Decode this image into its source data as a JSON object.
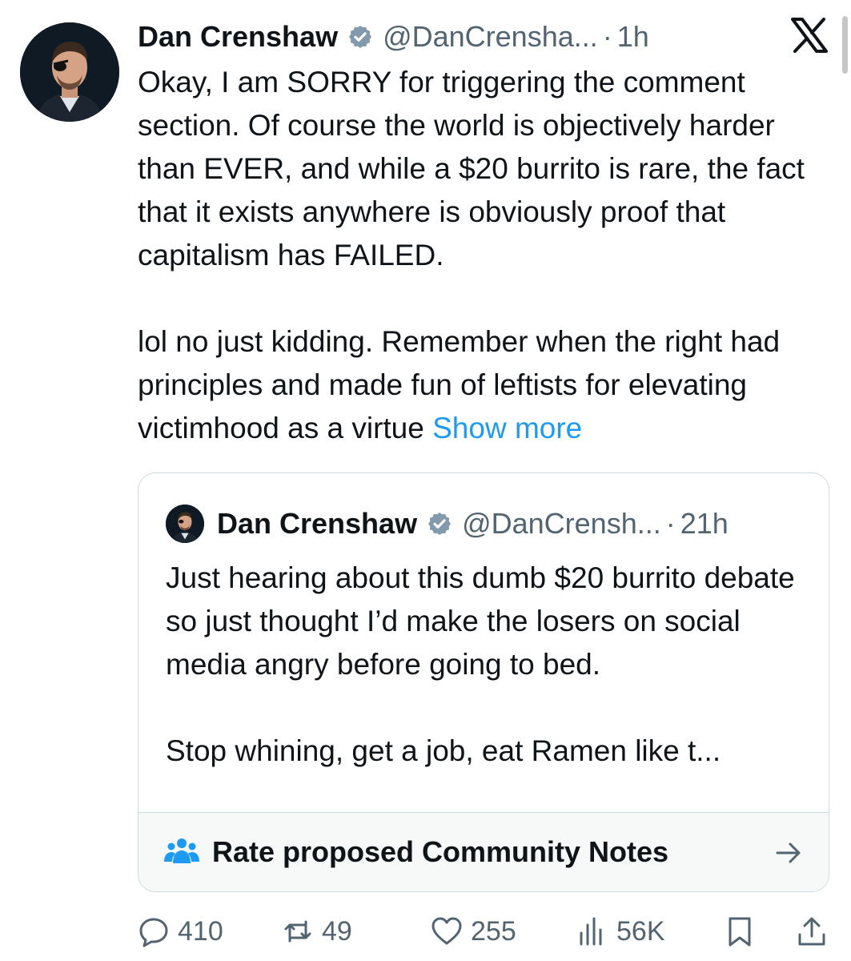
{
  "tweet": {
    "author_name": "Dan Crenshaw",
    "handle": "@DanCrensha...",
    "separator": "·",
    "time": "1h",
    "paragraphs": [
      "Okay, I am SORRY for triggering the comment section. Of course the world is objectively harder than EVER, and while a $20 burrito is rare, the fact that it exists anywhere is obviously proof that capitalism has FAILED.",
      "lol no just kidding. Remember when the right had principles and made fun of leftists for elevating victimhood as a virtue"
    ],
    "show_more": "Show more"
  },
  "quote": {
    "author_name": "Dan Crenshaw",
    "handle": "@DanCrensh...",
    "separator": "·",
    "time": "21h",
    "paragraphs": [
      "Just hearing about this dumb $20 burrito debate so just thought I’d make the losers on social media angry before going to bed.",
      "Stop whining, get a job, eat Ramen like t..."
    ]
  },
  "community_notes": {
    "label": "Rate proposed Community Notes",
    "icon": "people-icon"
  },
  "actions": {
    "replies": "410",
    "reposts": "49",
    "likes": "255",
    "views": "56K"
  },
  "colors": {
    "text": "#0f1419",
    "secondary": "#536471",
    "link": "#1d9bf0",
    "border": "#cfd9de",
    "verified_badge": "#829aab"
  }
}
